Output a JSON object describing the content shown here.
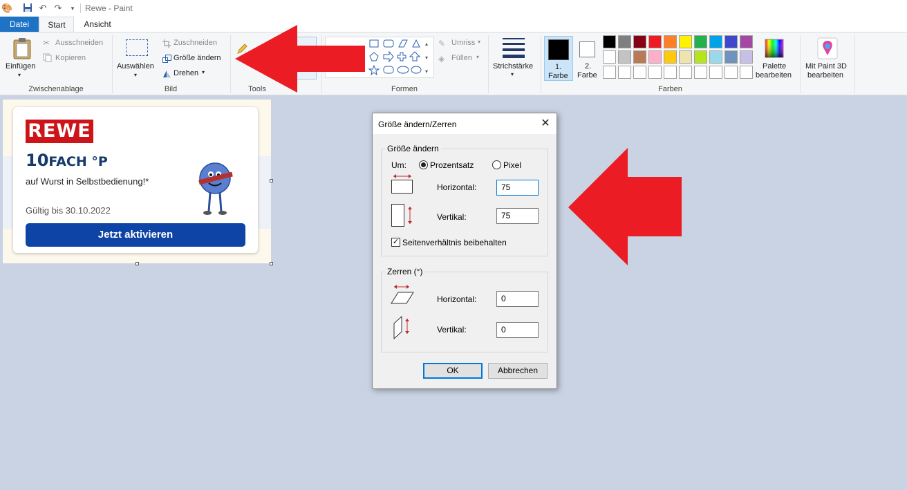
{
  "window": {
    "title": "Rewe - Paint"
  },
  "tabs": {
    "file": "Datei",
    "start": "Start",
    "view": "Ansicht"
  },
  "ribbon": {
    "clipboard": {
      "paste": "Einfügen",
      "cut": "Ausschneiden",
      "copy": "Kopieren",
      "label": "Zwischenablage"
    },
    "image": {
      "select": "Auswählen",
      "crop": "Zuschneiden",
      "resize": "Größe ändern",
      "rotate": "Drehen",
      "label": "Bild"
    },
    "tools": {
      "label": "Tools"
    },
    "shapes": {
      "outline": "Umriss",
      "fill": "Füllen",
      "label": "Formen"
    },
    "stroke": {
      "label": "Strichstärke"
    },
    "colors": {
      "color1_line1": "1.",
      "color1_line2": "Farbe",
      "color2_line1": "2.",
      "color2_line2": "Farbe",
      "edit_line1": "Palette",
      "edit_line2": "bearbeiten",
      "label": "Farben",
      "color1": "#000000",
      "color2": "#ffffff",
      "row1": [
        "#000000",
        "#7f7f7f",
        "#880015",
        "#ed1c24",
        "#ff7f27",
        "#fff200",
        "#22b14c",
        "#00a2e8",
        "#3f48cc",
        "#a349a4"
      ],
      "row2": [
        "#ffffff",
        "#c3c3c3",
        "#b97a57",
        "#ffaec9",
        "#ffc90e",
        "#efe4b0",
        "#b5e61d",
        "#99d9ea",
        "#7092be",
        "#c8bfe7"
      ]
    },
    "paint3d": {
      "line1": "Mit Paint 3D",
      "line2": "bearbeiten"
    }
  },
  "canvas": {
    "logo": "REWE",
    "headline_big": "10",
    "headline_rest": "FACH °P",
    "subtitle": "auf Wurst in Selbstbedienung!*",
    "valid": "Gültig bis 30.10.2022",
    "button": "Jetzt aktivieren"
  },
  "dialog": {
    "title": "Größe ändern/Zerren",
    "resize_group": "Größe ändern",
    "by_label": "Um:",
    "percent": "Prozentsatz",
    "pixel": "Pixel",
    "horizontal_label": "Horizontal:",
    "horizontal_value": "75",
    "vertical_label": "Vertikal:",
    "vertical_value": "75",
    "keep_ratio": "Seitenverhältnis beibehalten",
    "skew_group": "Zerren (°)",
    "skew_horizontal_label": "Horizontal:",
    "skew_horizontal_value": "0",
    "skew_vertical_label": "Vertikal:",
    "skew_vertical_value": "0",
    "ok": "OK",
    "cancel": "Abbrechen"
  },
  "annotation_color": "#ec1c24"
}
